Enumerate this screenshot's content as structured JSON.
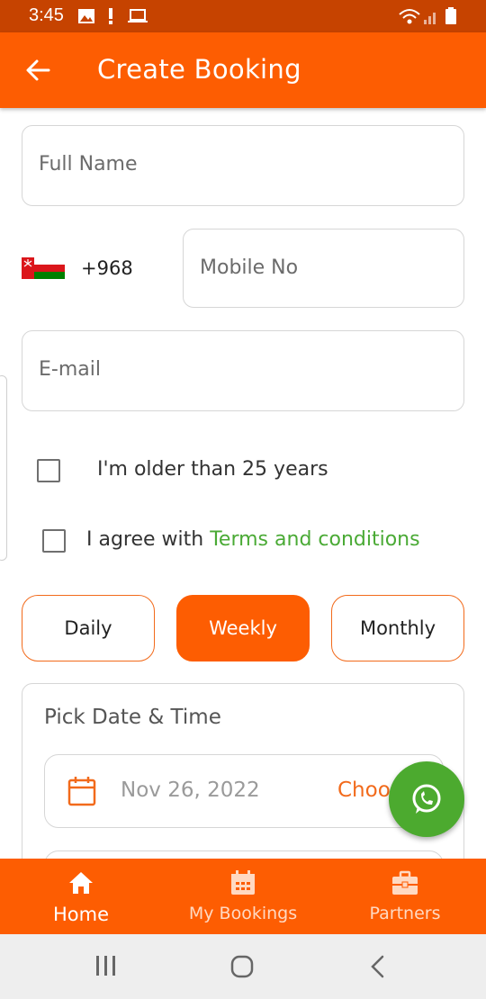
{
  "status_bar": {
    "time": "3:45",
    "icons": [
      "image-icon",
      "alert-icon",
      "laptop-icon",
      "wifi-icon",
      "signal-icon",
      "battery-icon"
    ]
  },
  "app_bar": {
    "back_icon": "arrow-left-icon",
    "title": "Create Booking"
  },
  "form": {
    "full_name_placeholder": "Full Name",
    "country_flag": "oman-flag",
    "dial_code": "+968",
    "mobile_placeholder": "Mobile No",
    "email_placeholder": "E-mail",
    "age_check_label": "I'm older than 25 years",
    "terms_prefix": "I agree with ",
    "terms_link": "Terms and conditions"
  },
  "period_options": {
    "daily": "Daily",
    "weekly": "Weekly",
    "monthly": "Monthly",
    "selected": "Weekly"
  },
  "pick_date": {
    "title": "Pick Date & Time",
    "date_value": "Nov 26, 2022",
    "choose_label": "Choo"
  },
  "fab": {
    "icon": "whatsapp-icon"
  },
  "bottom_nav": {
    "items": [
      {
        "label": "Home",
        "icon": "home-icon",
        "active": true
      },
      {
        "label": "My Bookings",
        "icon": "calendar-icon",
        "active": false
      },
      {
        "label": "Partners",
        "icon": "briefcase-icon",
        "active": false
      }
    ]
  },
  "system_nav": [
    "recents-icon",
    "home-circle-icon",
    "back-chevron-icon"
  ],
  "colors": {
    "primary": "#fd5d02",
    "status_bar": "#c64300",
    "link_green": "#4aaa35",
    "whatsapp_green": "#4caa2f"
  }
}
